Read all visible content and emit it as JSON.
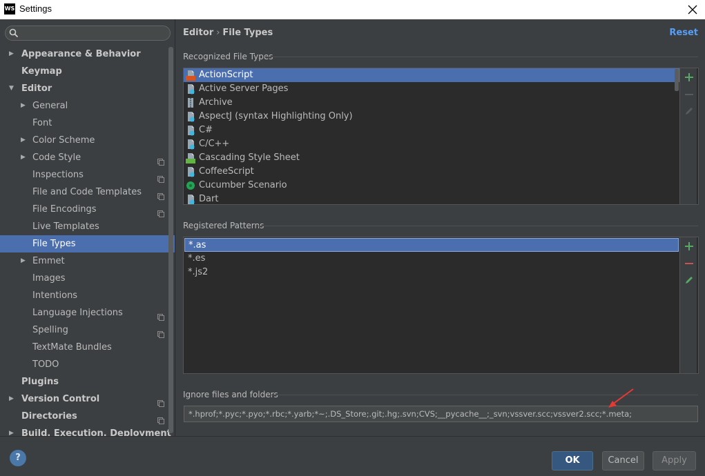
{
  "window": {
    "title": "Settings",
    "app_icon": "WS"
  },
  "search": {
    "placeholder": ""
  },
  "sidebar": {
    "items": [
      {
        "label": "Appearance & Behavior",
        "indent": 0,
        "arrow": "right",
        "bold": true,
        "proj": false
      },
      {
        "label": "Keymap",
        "indent": 0,
        "arrow": "",
        "bold": true,
        "proj": false
      },
      {
        "label": "Editor",
        "indent": 0,
        "arrow": "down",
        "bold": true,
        "proj": false
      },
      {
        "label": "General",
        "indent": 1,
        "arrow": "right",
        "bold": false,
        "proj": false
      },
      {
        "label": "Font",
        "indent": 1,
        "arrow": "",
        "bold": false,
        "proj": false
      },
      {
        "label": "Color Scheme",
        "indent": 1,
        "arrow": "right",
        "bold": false,
        "proj": false
      },
      {
        "label": "Code Style",
        "indent": 1,
        "arrow": "right",
        "bold": false,
        "proj": true
      },
      {
        "label": "Inspections",
        "indent": 1,
        "arrow": "",
        "bold": false,
        "proj": true
      },
      {
        "label": "File and Code Templates",
        "indent": 1,
        "arrow": "",
        "bold": false,
        "proj": true
      },
      {
        "label": "File Encodings",
        "indent": 1,
        "arrow": "",
        "bold": false,
        "proj": true
      },
      {
        "label": "Live Templates",
        "indent": 1,
        "arrow": "",
        "bold": false,
        "proj": false
      },
      {
        "label": "File Types",
        "indent": 1,
        "arrow": "",
        "bold": false,
        "proj": false,
        "selected": true
      },
      {
        "label": "Emmet",
        "indent": 1,
        "arrow": "right",
        "bold": false,
        "proj": false
      },
      {
        "label": "Images",
        "indent": 1,
        "arrow": "",
        "bold": false,
        "proj": false
      },
      {
        "label": "Intentions",
        "indent": 1,
        "arrow": "",
        "bold": false,
        "proj": false
      },
      {
        "label": "Language Injections",
        "indent": 1,
        "arrow": "",
        "bold": false,
        "proj": true
      },
      {
        "label": "Spelling",
        "indent": 1,
        "arrow": "",
        "bold": false,
        "proj": true
      },
      {
        "label": "TextMate Bundles",
        "indent": 1,
        "arrow": "",
        "bold": false,
        "proj": false
      },
      {
        "label": "TODO",
        "indent": 1,
        "arrow": "",
        "bold": false,
        "proj": false
      },
      {
        "label": "Plugins",
        "indent": 0,
        "arrow": "",
        "bold": true,
        "proj": false
      },
      {
        "label": "Version Control",
        "indent": 0,
        "arrow": "right",
        "bold": true,
        "proj": true
      },
      {
        "label": "Directories",
        "indent": 0,
        "arrow": "",
        "bold": true,
        "proj": true
      },
      {
        "label": "Build, Execution, Deployment",
        "indent": 0,
        "arrow": "right",
        "bold": true,
        "proj": false
      }
    ]
  },
  "breadcrumb": {
    "parent": "Editor",
    "separator": "›",
    "current": "File Types"
  },
  "reset_label": "Reset",
  "recognized": {
    "title": "Recognized File Types",
    "items": [
      {
        "label": "ActionScript",
        "icon": "as-file-icon",
        "color": "#d9531e",
        "tag": "AS"
      },
      {
        "label": "Active Server Pages",
        "icon": "asp-file-icon",
        "color": "#40b6e0",
        "tag": ""
      },
      {
        "label": "Archive",
        "icon": "archive-file-icon",
        "color": "#8fb3c9",
        "tag": ""
      },
      {
        "label": "AspectJ (syntax Highlighting Only)",
        "icon": "aspectj-file-icon",
        "color": "#40b6e0",
        "tag": ""
      },
      {
        "label": "C#",
        "icon": "csharp-file-icon",
        "color": "#40b6e0",
        "tag": ""
      },
      {
        "label": "C/C++",
        "icon": "cpp-file-icon",
        "color": "#40b6e0",
        "tag": ""
      },
      {
        "label": "Cascading Style Sheet",
        "icon": "css-file-icon",
        "color": "#62b543",
        "tag": "CSS"
      },
      {
        "label": "CoffeeScript",
        "icon": "coffeescript-file-icon",
        "color": "#40b6e0",
        "tag": ""
      },
      {
        "label": "Cucumber Scenario",
        "icon": "cucumber-file-icon",
        "color": "#23a455",
        "tag": ""
      },
      {
        "label": "Dart",
        "icon": "dart-file-icon",
        "color": "#40b6e0",
        "tag": ""
      }
    ]
  },
  "patterns": {
    "title": "Registered Patterns",
    "items": [
      "*.as",
      "*.es",
      "*.js2"
    ]
  },
  "ignore": {
    "title": "Ignore files and folders",
    "value": "*.hprof;*.pyc;*.pyo;*.rbc;*.yarb;*~;.DS_Store;.git;.hg;.svn;CVS;__pycache__;_svn;vssver.scc;vssver2.scc;*.meta;"
  },
  "footer": {
    "help": "?",
    "ok": "OK",
    "cancel": "Cancel",
    "apply": "Apply"
  },
  "colors": {
    "accent": "#4b6eaf",
    "link": "#589df6",
    "add": "#59a869",
    "remove": "#c75450",
    "annotation_arrow": "#e53935"
  }
}
